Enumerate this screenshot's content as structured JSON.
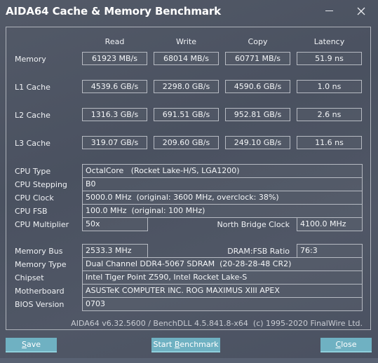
{
  "window": {
    "title": "AIDA64 Cache & Memory Benchmark",
    "minimize_icon": "minimize-icon",
    "close_icon": "close-icon"
  },
  "benchmark": {
    "columns": [
      "Read",
      "Write",
      "Copy",
      "Latency"
    ],
    "rows": [
      {
        "label": "Memory",
        "read": "61923 MB/s",
        "write": "68014 MB/s",
        "copy": "60771 MB/s",
        "latency": "51.9 ns"
      },
      {
        "label": "L1 Cache",
        "read": "4539.6 GB/s",
        "write": "2298.0 GB/s",
        "copy": "4590.6 GB/s",
        "latency": "1.0 ns"
      },
      {
        "label": "L2 Cache",
        "read": "1316.3 GB/s",
        "write": "691.51 GB/s",
        "copy": "952.81 GB/s",
        "latency": "2.6 ns"
      },
      {
        "label": "L3 Cache",
        "read": "319.07 GB/s",
        "write": "209.60 GB/s",
        "copy": "249.10 GB/s",
        "latency": "11.6 ns"
      }
    ]
  },
  "cpu": {
    "type_label": "CPU Type",
    "type_value": "OctalCore   (Rocket Lake-H/S, LGA1200)",
    "stepping_label": "CPU Stepping",
    "stepping_value": "B0",
    "clock_label": "CPU Clock",
    "clock_value": "5000.0 MHz  (original: 3600 MHz, overclock: 38%)",
    "fsb_label": "CPU FSB",
    "fsb_value": "100.0 MHz  (original: 100 MHz)",
    "multiplier_label": "CPU Multiplier",
    "multiplier_value": "50x",
    "nb_clock_label": "North Bridge Clock",
    "nb_clock_value": "4100.0 MHz"
  },
  "memory": {
    "bus_label": "Memory Bus",
    "bus_value": "2533.3 MHz",
    "ratio_label": "DRAM:FSB Ratio",
    "ratio_value": "76:3",
    "type_label": "Memory Type",
    "type_value": "Dual Channel DDR4-5067 SDRAM  (20-28-28-48 CR2)",
    "chipset_label": "Chipset",
    "chipset_value": "Intel Tiger Point Z590, Intel Rocket Lake-S",
    "motherboard_label": "Motherboard",
    "motherboard_value": "ASUSTeK COMPUTER INC. ROG MAXIMUS XIII APEX",
    "bios_label": "BIOS Version",
    "bios_value": "0703"
  },
  "footer": {
    "version_text": "AIDA64 v6.32.5600 / BenchDLL 4.5.841.8-x64  (c) 1995-2020 FinalWire Ltd."
  },
  "buttons": {
    "save_mnemonic": "S",
    "save_rest": "ave",
    "start_prefix": "Start ",
    "start_mnemonic": "B",
    "start_rest": "enchmark",
    "close_mnemonic": "C",
    "close_rest": "lose"
  },
  "colors": {
    "background": "#4a5160",
    "button": "#6fb1c2",
    "border": "#b6bac2"
  }
}
